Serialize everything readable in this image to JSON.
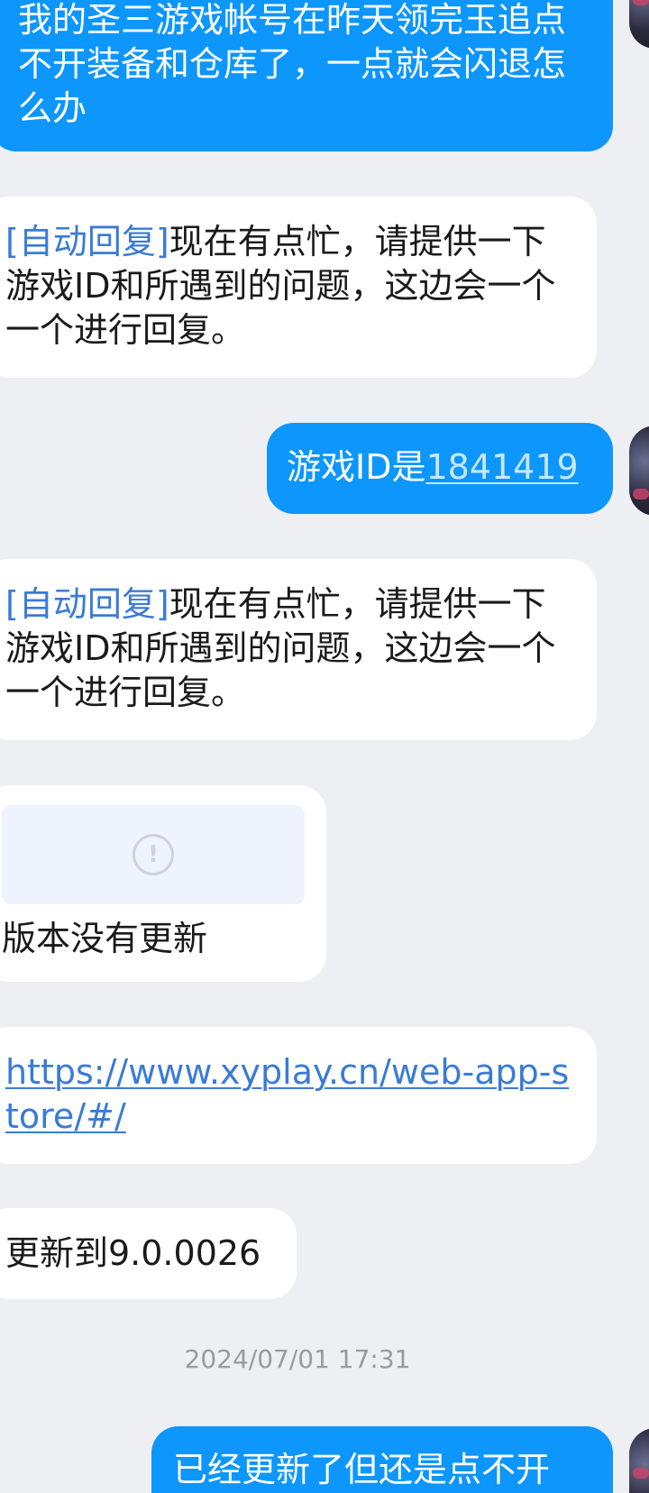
{
  "messages": [
    {
      "direction": "outgoing",
      "text": "我的圣三游戏帐号在昨天领完玉追点不开装备和仓库了，一点就会闪退怎么办"
    },
    {
      "direction": "incoming",
      "tag": "[自动回复]",
      "text": "现在有点忙，请提供一下游戏ID和所遇到的问题，这边会一个一个进行回复。"
    },
    {
      "direction": "outgoing",
      "text": "游戏ID是",
      "link": "1841419"
    },
    {
      "direction": "incoming",
      "tag": "[自动回复]",
      "text": "现在有点忙，请提供一下游戏ID和所遇到的问题，这边会一个一个进行回复。"
    },
    {
      "direction": "incoming",
      "image_placeholder_icon": "alert-circle-icon",
      "caption": "版本没有更新"
    },
    {
      "direction": "incoming",
      "link": "https://www.xyplay.cn/web-app-store/#/"
    },
    {
      "direction": "incoming",
      "text": "更新到9.0.0026"
    },
    {
      "direction": "outgoing",
      "text": "已经更新了但还是点不开"
    }
  ],
  "timestamp": "2024/07/01 17:31",
  "colors": {
    "background": "#eeeff3",
    "outgoing_bubble": "#0d96fc",
    "incoming_bubble": "#ffffff",
    "link": "#3a7bd5"
  }
}
